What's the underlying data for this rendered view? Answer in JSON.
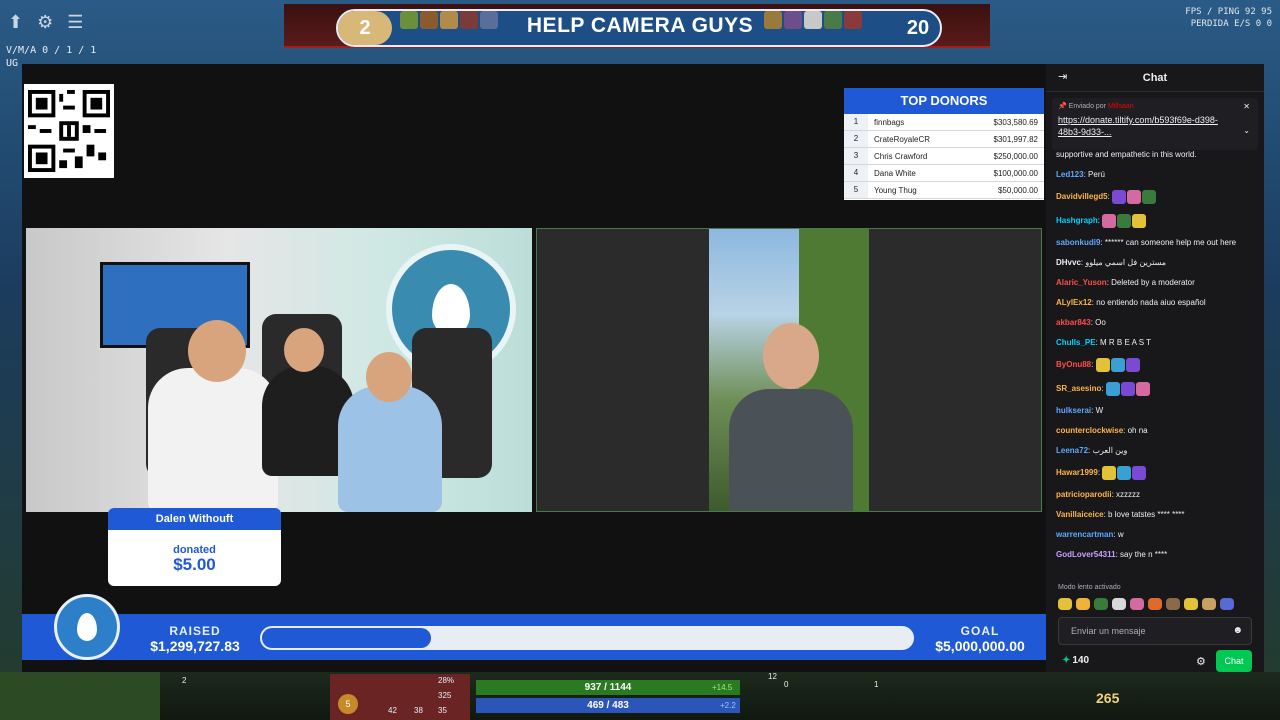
{
  "game_hud": {
    "left_icons": [
      "upload-icon",
      "gear-icon",
      "menu-icon"
    ],
    "vma_lines": [
      "V/M/A  0 / 1 / 1",
      "UG"
    ],
    "score_left": "2",
    "score_right": "20",
    "banner_title": "HELP CAMERA GUYS",
    "fps_line": "FPS / PING   92   95",
    "loss_line": "PERDIDA E/S   0   0",
    "hp": "937 / 1144",
    "hp_regen": "+14.5",
    "mp": "469 / 483",
    "mp_regen": "+2.2",
    "level": "5",
    "stat_1": "28%",
    "stat_2": "325",
    "stat_3": "35",
    "kills": "42",
    "deaths": "38",
    "item_count_1": "12",
    "item_count_2": "0",
    "item_count_3": "1",
    "minimap_level": "2",
    "gold": "265"
  },
  "top_donors": {
    "title": "TOP DONORS",
    "rows": [
      {
        "rank": "1",
        "name": "finnbags",
        "amount": "$303,580.69"
      },
      {
        "rank": "2",
        "name": "CrateRoyaleCR",
        "amount": "$301,997.82"
      },
      {
        "rank": "3",
        "name": "Chris Crawford",
        "amount": "$250,000.00"
      },
      {
        "rank": "4",
        "name": "Dana White",
        "amount": "$100,000.00"
      },
      {
        "rank": "5",
        "name": "Young Thug",
        "amount": "$50,000.00"
      }
    ]
  },
  "donation_alert": {
    "name": "Dalen Withouft",
    "verb": "donated",
    "amount": "$5.00"
  },
  "fundraiser": {
    "raised_label": "RAISED",
    "raised_amount": "$1,299,727.83",
    "goal_label": "GOAL",
    "goal_amount": "$5,000,000.00",
    "progress_fraction": 0.26
  },
  "chat": {
    "title": "Chat",
    "pinned_sent_by": "Enviado por",
    "pinned_user": "Millsaan",
    "pinned_link": "https://donate.tiltify.com/b593f69e-d398-48b3-9d33-...",
    "messages": [
      {
        "user": "",
        "color": "#efeff1",
        "text": "supportive and empathetic in this world."
      },
      {
        "user": "Led123",
        "color": "#5fa8ff",
        "text": "Perú"
      },
      {
        "user": "Davidvillegd5",
        "color": "#ffb547",
        "text": ""
      },
      {
        "user": "Hashgraph",
        "color": "#00d2ff",
        "text": ""
      },
      {
        "user": "sabonkudi9",
        "color": "#5fa8ff",
        "text": "****** can someone help me out here"
      },
      {
        "user": "DHvvc",
        "color": "#efeff1",
        "text": "مسترين فل اسمي ميلوو"
      },
      {
        "user": "Alaric_Yuson",
        "color": "#ff4d4d",
        "text": "Deleted by a moderator"
      },
      {
        "user": "ALylEx12",
        "color": "#ffb547",
        "text": "no entiendo nada aiuo español"
      },
      {
        "user": "akbar843",
        "color": "#ff4d4d",
        "text": "Oo"
      },
      {
        "user": "Chulls_PE",
        "color": "#00d2ff",
        "text": "M R  B E  A S T"
      },
      {
        "user": "ByOnu88",
        "color": "#ff4d4d",
        "text": ""
      },
      {
        "user": "SR_asesino",
        "color": "#ffb547",
        "text": ""
      },
      {
        "user": "hulkserai",
        "color": "#5fa8ff",
        "text": "W"
      },
      {
        "user": "counterclockwise",
        "color": "#ffb547",
        "text": "oh na"
      },
      {
        "user": "Leena72",
        "color": "#5fa8ff",
        "text": "وين العرب"
      },
      {
        "user": "Hawar1999",
        "color": "#ffb547",
        "text": ""
      },
      {
        "user": "patricioparodii",
        "color": "#ffb547",
        "text": "xzzzzz"
      },
      {
        "user": "Vanillaiceice",
        "color": "#ffb547",
        "text": "b love tatstes **** ****"
      },
      {
        "user": "warrencartman",
        "color": "#5fa8ff",
        "text": "w"
      },
      {
        "user": "GodLover54311",
        "color": "#c9a0ff",
        "text": "say the n ****"
      }
    ],
    "slow_mode": "Modo lento activado",
    "input_placeholder": "Enviar un mensaje",
    "points": "140",
    "send_label": "Chat"
  }
}
